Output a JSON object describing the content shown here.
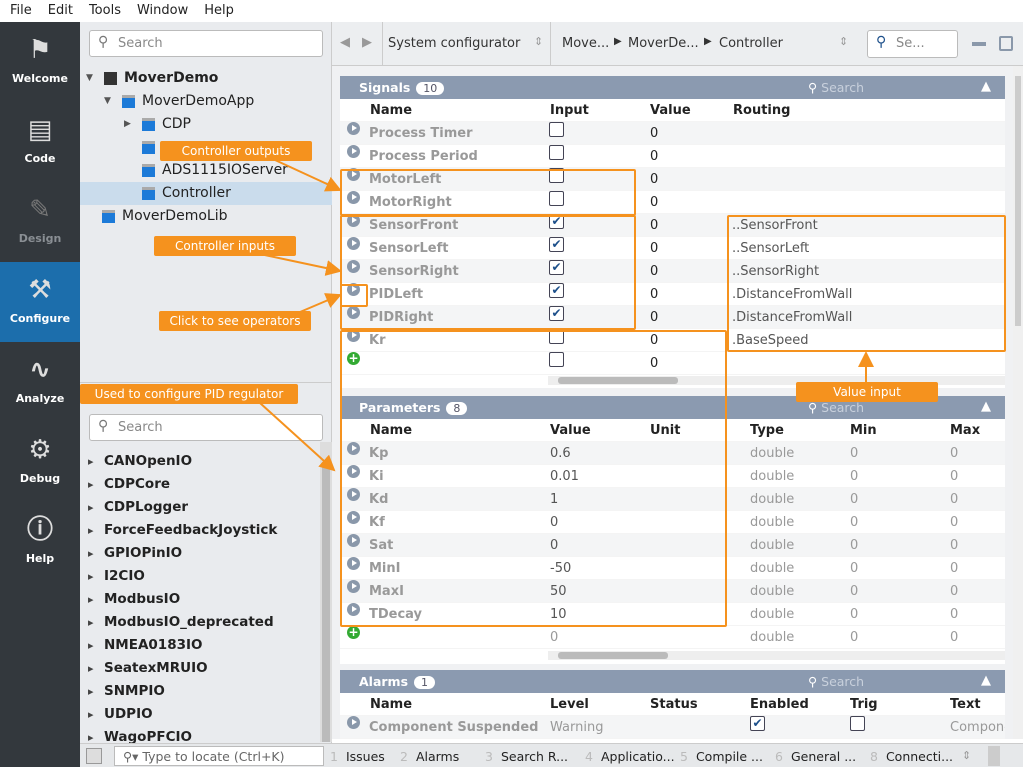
{
  "menu": [
    "File",
    "Edit",
    "Tools",
    "Window",
    "Help"
  ],
  "sidebar": [
    {
      "label": "Welcome",
      "icon": "flag-icon"
    },
    {
      "label": "Code",
      "icon": "document-icon"
    },
    {
      "label": "Design",
      "icon": "design-icon"
    },
    {
      "label": "Configure",
      "icon": "tools-icon",
      "active": true
    },
    {
      "label": "Analyze",
      "icon": "chart-icon"
    },
    {
      "label": "Debug",
      "icon": "debug-icon"
    },
    {
      "label": "Help",
      "icon": "info-icon"
    }
  ],
  "tree": {
    "search_placeholder": "Search",
    "items": [
      {
        "label": "MoverDemo",
        "level": 0,
        "bold": true
      },
      {
        "label": "MoverDemoApp",
        "level": 1
      },
      {
        "label": "CDP",
        "level": 2
      },
      {
        "label": "",
        "level": 2
      },
      {
        "label": "ADS1115IOServer",
        "level": 2
      },
      {
        "label": "Controller",
        "level": 2,
        "selected": true
      },
      {
        "label": "MoverDemoLib",
        "level": 0
      }
    ]
  },
  "library": {
    "search_placeholder": "Search",
    "items": [
      "CANOpenIO",
      "CDPCore",
      "CDPLogger",
      "ForceFeedbackJoystick",
      "GPIOPinIO",
      "I2CIO",
      "ModbusIO",
      "ModbusIO_deprecated",
      "NMEA0183IO",
      "SeatexMRUIO",
      "SNMPIO",
      "UDPIO",
      "WagoPFCIO"
    ]
  },
  "topbar": {
    "mode": "System configurator",
    "breadcrumb": [
      "Move...",
      "MoverDe...",
      "Controller"
    ],
    "search_placeholder": "Se..."
  },
  "signals": {
    "title": "Signals",
    "count": "10",
    "search_placeholder": "Search",
    "columns": [
      "Name",
      "Input",
      "Value",
      "Routing"
    ],
    "rows": [
      {
        "name": "Process Timer",
        "input": false,
        "value": "0",
        "routing": ""
      },
      {
        "name": "Process Period",
        "input": false,
        "value": "0",
        "routing": ""
      },
      {
        "name": "MotorLeft",
        "input": false,
        "value": "0",
        "routing": ""
      },
      {
        "name": "MotorRight",
        "input": false,
        "value": "0",
        "routing": ""
      },
      {
        "name": "SensorFront",
        "input": true,
        "value": "0",
        "routing": "..SensorFront"
      },
      {
        "name": "SensorLeft",
        "input": true,
        "value": "0",
        "routing": "..SensorLeft"
      },
      {
        "name": "SensorRight",
        "input": true,
        "value": "0",
        "routing": "..SensorRight"
      },
      {
        "name": "PIDLeft",
        "input": true,
        "value": "0",
        "routing": ".DistanceFromWall"
      },
      {
        "name": "PIDRight",
        "input": true,
        "value": "0",
        "routing": ".DistanceFromWall"
      },
      {
        "name": "Kr",
        "input": false,
        "value": "0",
        "routing": ".BaseSpeed"
      }
    ],
    "new_row_value": "0"
  },
  "parameters": {
    "title": "Parameters",
    "count": "8",
    "search_placeholder": "Search",
    "columns": [
      "Name",
      "Value",
      "Unit",
      "Type",
      "Min",
      "Max"
    ],
    "rows": [
      {
        "name": "Kp",
        "value": "0.6",
        "unit": "",
        "type": "double",
        "min": "0",
        "max": "0"
      },
      {
        "name": "Ki",
        "value": "0.01",
        "unit": "",
        "type": "double",
        "min": "0",
        "max": "0"
      },
      {
        "name": "Kd",
        "value": "1",
        "unit": "",
        "type": "double",
        "min": "0",
        "max": "0"
      },
      {
        "name": "Kf",
        "value": "0",
        "unit": "",
        "type": "double",
        "min": "0",
        "max": "0"
      },
      {
        "name": "Sat",
        "value": "0",
        "unit": "",
        "type": "double",
        "min": "0",
        "max": "0"
      },
      {
        "name": "MinI",
        "value": "-50",
        "unit": "",
        "type": "double",
        "min": "0",
        "max": "0"
      },
      {
        "name": "MaxI",
        "value": "50",
        "unit": "",
        "type": "double",
        "min": "0",
        "max": "0"
      },
      {
        "name": "TDecay",
        "value": "10",
        "unit": "",
        "type": "double",
        "min": "0",
        "max": "0"
      }
    ],
    "new_row": {
      "value": "0",
      "type": "double",
      "min": "0",
      "max": "0"
    }
  },
  "alarms": {
    "title": "Alarms",
    "count": "1",
    "search_placeholder": "Search",
    "columns": [
      "Name",
      "Level",
      "Status",
      "Enabled",
      "Trig",
      "Text"
    ],
    "rows": [
      {
        "name": "Component Suspended",
        "level": "Warning",
        "status": "",
        "enabled": true,
        "trig": false,
        "text": "Compone"
      }
    ]
  },
  "annotations": {
    "outputs": "Controller outputs",
    "inputs": "Controller inputs",
    "operators": "Click to see operators",
    "pid": "Used to configure PID regulator",
    "value_input": "Value input"
  },
  "statusbar": {
    "locate_placeholder": "Type to locate (Ctrl+K)",
    "tabs": [
      {
        "num": "1",
        "label": "Issues"
      },
      {
        "num": "2",
        "label": "Alarms"
      },
      {
        "num": "3",
        "label": "Search R..."
      },
      {
        "num": "4",
        "label": "Applicatio..."
      },
      {
        "num": "5",
        "label": "Compile ..."
      },
      {
        "num": "6",
        "label": "General ..."
      },
      {
        "num": "8",
        "label": "Connecti..."
      }
    ]
  },
  "colors": {
    "accent": "#1c6eac",
    "annotation": "#f5921e",
    "section_header": "#8b9ab0"
  }
}
